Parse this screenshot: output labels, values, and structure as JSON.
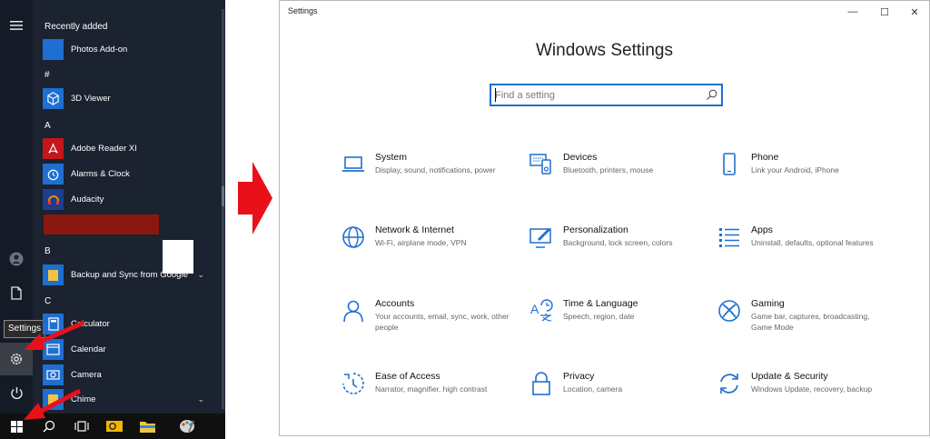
{
  "start_menu": {
    "recently_added_header": "Recently added",
    "tooltip": "Settings",
    "groups": [
      {
        "header": "",
        "apps": [
          {
            "name": "Photos Add-on",
            "icon": "photos-addon-icon"
          }
        ]
      },
      {
        "header": "#",
        "apps": [
          {
            "name": "3D Viewer",
            "icon": "cube-icon"
          }
        ]
      },
      {
        "header": "A",
        "apps": [
          {
            "name": "Adobe Reader XI",
            "icon": "adobe-reader-icon"
          },
          {
            "name": "Alarms & Clock",
            "icon": "alarm-clock-icon"
          },
          {
            "name": "Audacity",
            "icon": "audacity-icon"
          }
        ]
      },
      {
        "header": "B",
        "apps": [
          {
            "name": "Backup and Sync from Google",
            "icon": "folder-icon"
          }
        ]
      },
      {
        "header": "C",
        "apps": [
          {
            "name": "Calculator",
            "icon": "calculator-icon"
          },
          {
            "name": "Calendar",
            "icon": "calendar-icon"
          },
          {
            "name": "Camera",
            "icon": "camera-icon"
          },
          {
            "name": "Chime",
            "icon": "folder-icon"
          }
        ]
      }
    ],
    "rail_icons": [
      "hamburger-icon",
      "user-icon",
      "document-icon",
      "gear-icon",
      "power-icon"
    ],
    "taskbar_icons": [
      "windows-icon",
      "search-icon",
      "task-view-icon",
      "outlook-icon",
      "file-explorer-icon",
      "paint-icon"
    ]
  },
  "settings_window": {
    "title": "Settings",
    "heading": "Windows Settings",
    "search_placeholder": "Find a setting",
    "controls": {
      "minimize": "—",
      "maximize": "☐",
      "close": "✕"
    },
    "accent_color": "#1f6fd1",
    "tiles": [
      {
        "title": "System",
        "desc": "Display, sound, notifications, power",
        "icon": "laptop-icon"
      },
      {
        "title": "Devices",
        "desc": "Bluetooth, printers, mouse",
        "icon": "devices-icon"
      },
      {
        "title": "Phone",
        "desc": "Link your Android, iPhone",
        "icon": "phone-icon"
      },
      {
        "title": "Network & Internet",
        "desc": "Wi-Fi, airplane mode, VPN",
        "icon": "globe-icon"
      },
      {
        "title": "Personalization",
        "desc": "Background, lock screen, colors",
        "icon": "paint-brush-icon"
      },
      {
        "title": "Apps",
        "desc": "Uninstall, defaults, optional features",
        "icon": "apps-list-icon"
      },
      {
        "title": "Accounts",
        "desc": "Your accounts, email, sync, work, other people",
        "icon": "person-icon"
      },
      {
        "title": "Time & Language",
        "desc": "Speech, region, date",
        "icon": "time-language-icon"
      },
      {
        "title": "Gaming",
        "desc": "Game bar, captures, broadcasting, Game Mode",
        "icon": "xbox-icon"
      },
      {
        "title": "Ease of Access",
        "desc": "Narrator, magnifier, high contrast",
        "icon": "ease-of-access-icon"
      },
      {
        "title": "Privacy",
        "desc": "Location, camera",
        "icon": "lock-icon"
      },
      {
        "title": "Update & Security",
        "desc": "Windows Update, recovery, backup",
        "icon": "update-icon"
      }
    ]
  },
  "annotation_color": "#e8111a"
}
